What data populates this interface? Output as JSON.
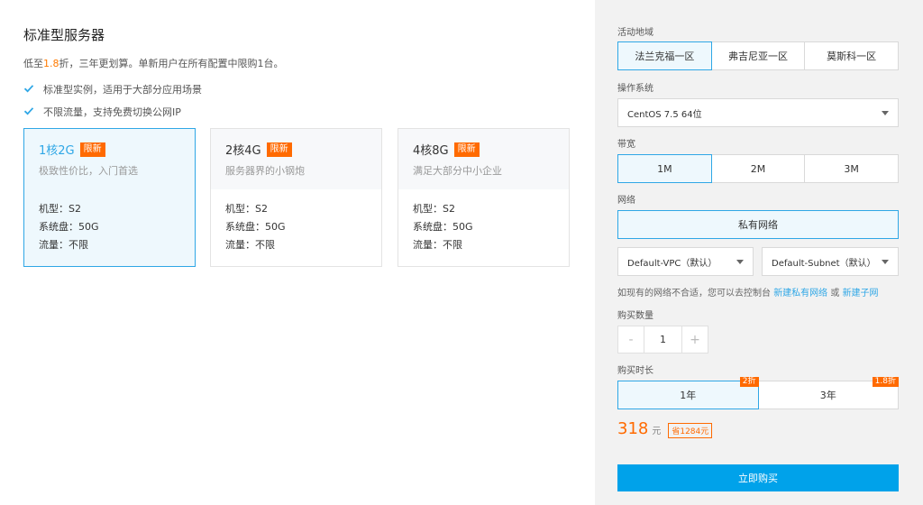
{
  "left": {
    "title": "标准型服务器",
    "subtitle_prefix": "低至",
    "subtitle_discount": "1.8",
    "subtitle_suffix": "折，三年更划算。单新用户在所有配置中限购1台。",
    "features": [
      "标准型实例，适用于大部分应用场景",
      "不限流量，支持免费切换公网IP"
    ],
    "cards": [
      {
        "name": "1核2G",
        "badge": "限新",
        "desc": "极致性价比，入门首选",
        "specs": [
          "机型：S2",
          "系统盘：50G",
          "流量：不限"
        ]
      },
      {
        "name": "2核4G",
        "badge": "限新",
        "desc": "服务器界的小钢炮",
        "specs": [
          "机型：S2",
          "系统盘：50G",
          "流量：不限"
        ]
      },
      {
        "name": "4核8G",
        "badge": "限新",
        "desc": "满足大部分中小企业",
        "specs": [
          "机型：S2",
          "系统盘：50G",
          "流量：不限"
        ]
      }
    ]
  },
  "right": {
    "region_label": "活动地域",
    "regions": [
      "法兰克福一区",
      "弗吉尼亚一区",
      "莫斯科一区"
    ],
    "os_label": "操作系统",
    "os_value": "CentOS 7.5 64位",
    "bandwidth_label": "带宽",
    "bandwidths": [
      "1M",
      "2M",
      "3M"
    ],
    "network_label": "网络",
    "network_type": "私有网络",
    "vpc_value": "Default-VPC（默认）",
    "subnet_value": "Default-Subnet（默认）",
    "hint_text": "如现有的网络不合适，您可以去控制台",
    "hint_link1": "新建私有网络",
    "hint_or": "或",
    "hint_link2": "新建子网",
    "quantity_label": "购买数量",
    "quantity_minus": "-",
    "quantity_value": "1",
    "quantity_plus": "+",
    "duration_label": "购买时长",
    "durations": [
      {
        "label": "1年",
        "badge": "2折"
      },
      {
        "label": "3年",
        "badge": "1.8折"
      }
    ],
    "price": "318",
    "price_unit": "元",
    "price_save": "省1284元",
    "buy_label": "立即购买"
  },
  "colors": {
    "accent": "#2fa7e6",
    "orange": "#ff6a00",
    "buy": "#00a2ea"
  }
}
